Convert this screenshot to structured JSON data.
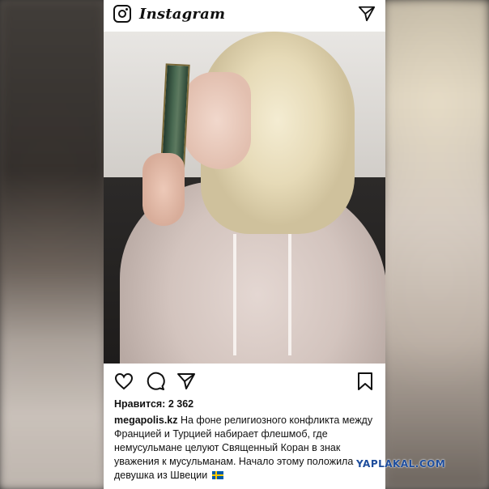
{
  "header": {
    "wordmark": "Instagram",
    "camera_icon": "camera-icon",
    "send_icon": "direct-send-icon"
  },
  "post": {
    "photo_alt": "photo",
    "actions": {
      "like_icon": "heart-icon",
      "comment_icon": "comment-icon",
      "share_icon": "send-icon",
      "save_icon": "bookmark-icon"
    },
    "likes": "Нравится: 2 362",
    "caption": {
      "username": "megapolis.kz",
      "text": "На фоне религиозного  конфликта между Францией и Турцией набирает флешмоб, где немусульмане целуют Священный Коран в знак уважения к мусульманам. Начало этому положила девушка из Швеции",
      "flag_icon": "sweden-flag-icon"
    }
  },
  "watermark": "YAPLAKAL.COM",
  "colors": {
    "background": "#ffffff",
    "text": "#111111",
    "watermark": "#1e4d9c"
  }
}
